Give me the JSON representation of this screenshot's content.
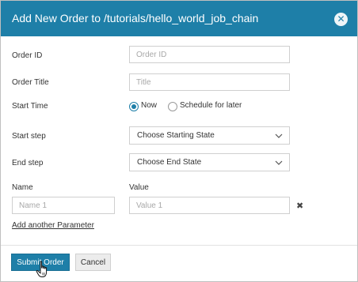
{
  "header": {
    "title": "Add New Order to /tutorials/hello_world_job_chain",
    "close_icon": "close-icon"
  },
  "form": {
    "order_id": {
      "label": "Order ID",
      "placeholder": "Order ID",
      "value": ""
    },
    "order_title": {
      "label": "Order Title",
      "placeholder": "Title",
      "value": ""
    },
    "start_time": {
      "label": "Start Time",
      "options": [
        {
          "label": "Now",
          "selected": true
        },
        {
          "label": "Schedule for later",
          "selected": false
        }
      ]
    },
    "start_step": {
      "label": "Start step",
      "selected": "Choose Starting State"
    },
    "end_step": {
      "label": "End step",
      "selected": "Choose End State"
    },
    "parameters": {
      "name_header": "Name",
      "value_header": "Value",
      "rows": [
        {
          "name_placeholder": "Name 1",
          "value_placeholder": "Value 1"
        }
      ],
      "add_link": "Add another Parameter"
    }
  },
  "footer": {
    "submit_label": "Submit Order",
    "cancel_label": "Cancel"
  },
  "colors": {
    "accent": "#1e7fa8",
    "header_text": "#ffffff"
  }
}
